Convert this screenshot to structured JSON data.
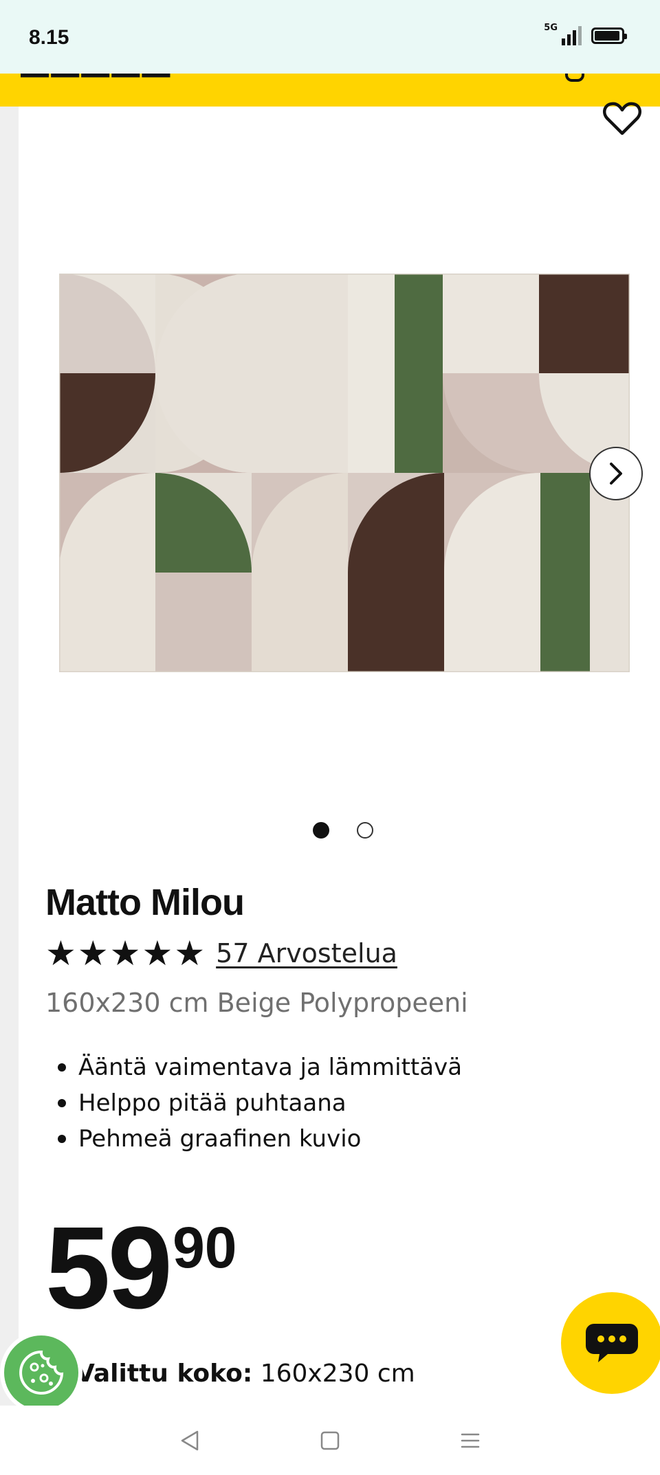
{
  "status_bar": {
    "time": "8.15",
    "network": "5G"
  },
  "product": {
    "title": "Matto Milou",
    "rating_stars": 5,
    "reviews_label": "57 Arvostelua",
    "subtitle": "160x230 cm Beige Polypropeeni",
    "features": [
      "Ääntä vaimentava ja lämmittävä",
      "Helppo pitää puhtaana",
      "Pehmeä graafinen kuvio"
    ],
    "price_integer": "59",
    "price_decimal": "90",
    "size_label": "Valittu koko:",
    "size_value": "160x230 cm"
  },
  "carousel": {
    "total_images": 2,
    "active_index": 0
  },
  "colors": {
    "brand_yellow": "#ffd400",
    "status_bar_bg": "#eaf9f6",
    "cookie_green": "#5cb85c",
    "rug_cream": "#e9e3da",
    "rug_taupe": "#c9b6ae",
    "rug_brown": "#4a3128",
    "rug_green": "#4f6b41"
  },
  "icons": {
    "favorite": "heart-outline-icon",
    "next": "chevron-right-icon",
    "cookie": "cookie-icon",
    "chat": "chat-bubble-icon",
    "back": "triangle-back-icon",
    "home": "square-home-icon",
    "menu": "hamburger-menu-icon"
  }
}
